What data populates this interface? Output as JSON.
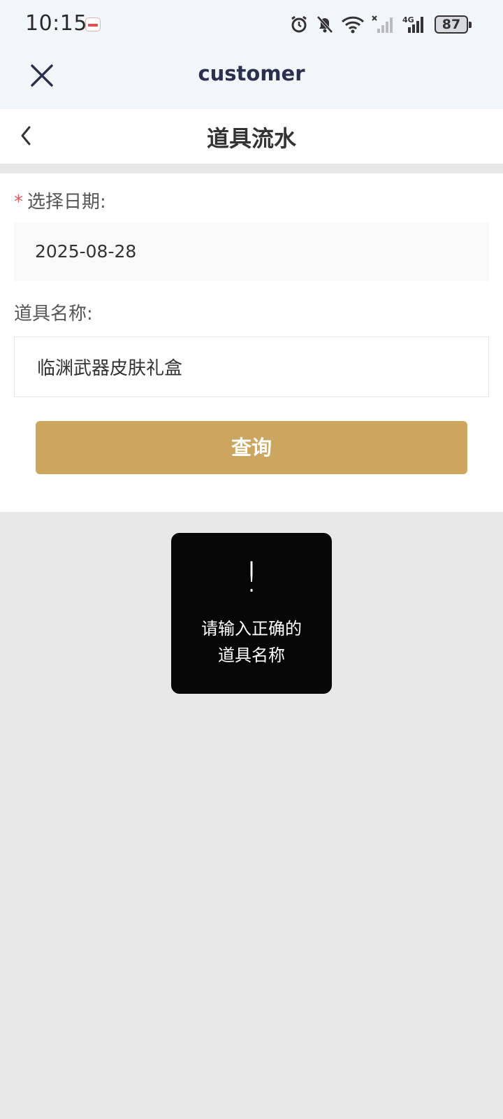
{
  "status_bar": {
    "time": "10:15",
    "battery": "87",
    "icons": [
      "alarm-icon",
      "bell-off-icon",
      "wifi-icon",
      "signal-off-icon",
      "signal-4g-icon",
      "battery-icon"
    ]
  },
  "app_header": {
    "title": "customer",
    "close_icon": "close-icon"
  },
  "page_nav": {
    "title": "道具流水",
    "back_icon": "chevron-left-icon"
  },
  "form": {
    "date_label": "选择日期:",
    "required_mark": "*",
    "date_value": "2025-08-28",
    "name_label": "道具名称:",
    "name_value": "临渊武器皮肤礼盒",
    "query_label": "查询"
  },
  "toast": {
    "icon_text": "!",
    "message_line1": "请输入正确的",
    "message_line2": "道具名称"
  },
  "colors": {
    "accent": "#cca55e",
    "required": "#e05b5b",
    "header_bg": "#f1f6f9",
    "page_bg": "#e8e8e8"
  }
}
